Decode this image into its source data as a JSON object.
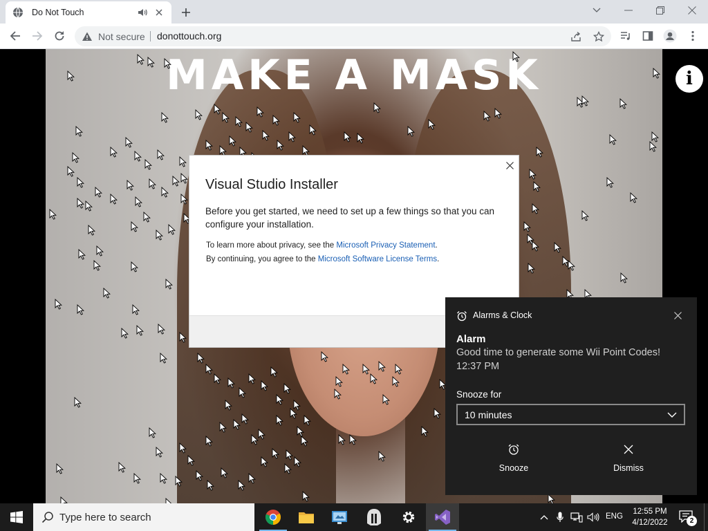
{
  "browser": {
    "tab_title": "Do Not Touch",
    "security_label": "Not secure",
    "url": "donottouch.org"
  },
  "page": {
    "title": "MAKE A MASK",
    "info_glyph": "i"
  },
  "dialog": {
    "title": "Visual Studio Installer",
    "body": "Before you get started, we need to set up a few things so that you can configure your installation.",
    "privacy_prefix": "To learn more about privacy, see the ",
    "privacy_link": "Microsoft Privacy Statement",
    "privacy_suffix": ".",
    "license_prefix": "By continuing, you agree to the ",
    "license_link": "Microsoft Software License Terms",
    "license_suffix": "."
  },
  "toast": {
    "app_name": "Alarms & Clock",
    "heading": "Alarm",
    "message": "Good time to generate some Wii Point Codes!",
    "time": "12:37 PM",
    "snooze_label": "Snooze for",
    "snooze_value": "10 minutes",
    "snooze_button": "Snooze",
    "dismiss_button": "Dismiss"
  },
  "taskbar": {
    "search_placeholder": "Type here to search",
    "language": "ENG",
    "time": "12:55 PM",
    "date": "4/12/2022",
    "notification_count": "2"
  },
  "colors": {
    "link": "#1a5fb4",
    "taskbar_bg": "#1c1c1c",
    "toast_bg": "#1f1f1f",
    "running_indicator": "#76b9ed"
  }
}
